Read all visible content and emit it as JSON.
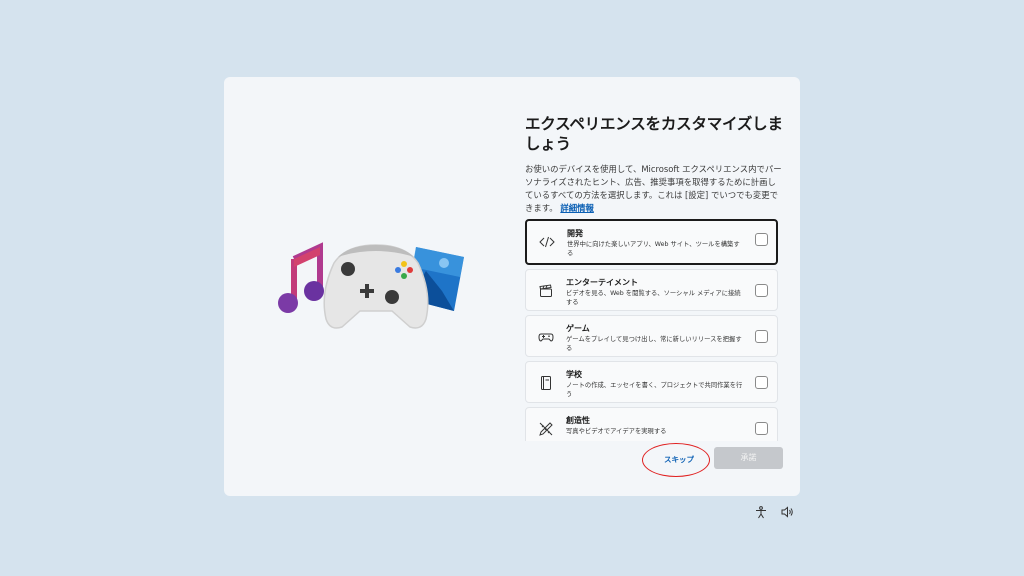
{
  "title": "エクスペリエンスをカスタマイズしましょう",
  "description": "お使いのデバイスを使用して、Microsoft エクスペリエンス内でパーソナライズされたヒント、広告、推奨事項を取得するために計画しているすべての方法を選択します。これは [設定] でいつでも変更できます。",
  "learn_more": "詳細情報",
  "options": [
    {
      "title": "開発",
      "desc": "世界中に向けた楽しいアプリ、Web サイト、ツールを構築する",
      "icon": "code-icon",
      "checked": false
    },
    {
      "title": "エンターテイメント",
      "desc": "ビデオを見る、Web を閲覧する、ソーシャル メディアに接続する",
      "icon": "clapperboard-icon",
      "checked": false
    },
    {
      "title": "ゲーム",
      "desc": "ゲームをプレイして見つけ出し、常に新しいリリースを把握する",
      "icon": "gamepad-icon",
      "checked": false
    },
    {
      "title": "学校",
      "desc": "ノートの作成、エッセイを書く、プロジェクトで共同作業を行う",
      "icon": "notebook-icon",
      "checked": false
    },
    {
      "title": "創造性",
      "desc": "写真やビデオでアイデアを実現する",
      "icon": "pen-ruler-icon",
      "checked": false
    }
  ],
  "buttons": {
    "skip": "スキップ",
    "accept": "承諾"
  },
  "colors": {
    "background": "#d5e3ee",
    "card": "#f3f6f9",
    "link": "#0a5fb4",
    "highlight_ring": "#e02020",
    "disabled_button": "#c5c8cc"
  },
  "system_icons": [
    "accessibility-icon",
    "volume-icon"
  ]
}
